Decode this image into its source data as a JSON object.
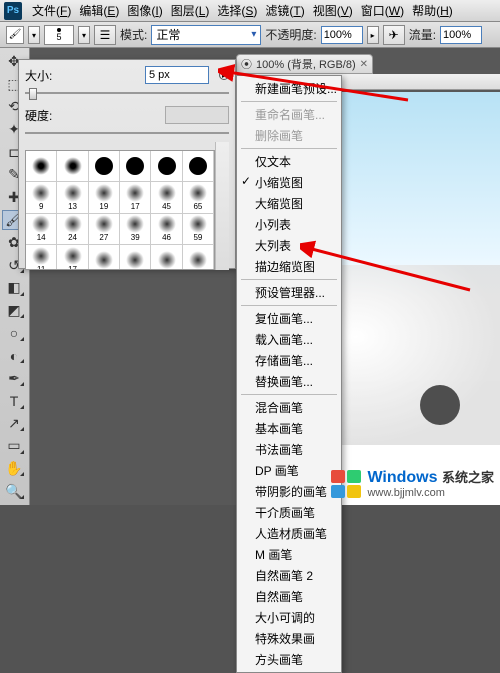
{
  "app": {
    "logo_text": "Ps"
  },
  "menubar": {
    "items": [
      {
        "label": "文件",
        "key": "F"
      },
      {
        "label": "编辑",
        "key": "E"
      },
      {
        "label": "图像",
        "key": "I"
      },
      {
        "label": "图层",
        "key": "L"
      },
      {
        "label": "选择",
        "key": "S"
      },
      {
        "label": "滤镜",
        "key": "T"
      },
      {
        "label": "视图",
        "key": "V"
      },
      {
        "label": "窗口",
        "key": "W"
      },
      {
        "label": "帮助",
        "key": "H"
      }
    ]
  },
  "optionsbar": {
    "brush_size_preview": "5",
    "mode_label": "模式:",
    "mode_value": "正常",
    "opacity_label": "不透明度:",
    "opacity_value": "100%",
    "flow_label": "流量:",
    "flow_value": "100%"
  },
  "document_tab": {
    "title": "100% (背景, RGB/8)"
  },
  "brush_popup": {
    "size_label": "大小:",
    "size_value": "5 px",
    "hardness_label": "硬度:",
    "presets": [
      {
        "type": "soft",
        "n": ""
      },
      {
        "type": "soft",
        "n": ""
      },
      {
        "type": "hard",
        "n": ""
      },
      {
        "type": "hard",
        "n": ""
      },
      {
        "type": "hard",
        "n": ""
      },
      {
        "type": "hard",
        "n": ""
      },
      {
        "type": "sc",
        "n": "9"
      },
      {
        "type": "sc",
        "n": "13"
      },
      {
        "type": "sc",
        "n": "19"
      },
      {
        "type": "sc",
        "n": "17"
      },
      {
        "type": "sc",
        "n": "45"
      },
      {
        "type": "sc",
        "n": "65"
      },
      {
        "type": "sc",
        "n": "14"
      },
      {
        "type": "sc",
        "n": "24"
      },
      {
        "type": "sc",
        "n": "27"
      },
      {
        "type": "sc",
        "n": "39"
      },
      {
        "type": "sc",
        "n": "46"
      },
      {
        "type": "sc",
        "n": "59"
      },
      {
        "type": "sc",
        "n": "11"
      },
      {
        "type": "sc",
        "n": "17"
      },
      {
        "type": "sc",
        "n": ""
      },
      {
        "type": "sc",
        "n": ""
      },
      {
        "type": "sc",
        "n": ""
      },
      {
        "type": "sc",
        "n": ""
      }
    ]
  },
  "context_menu": {
    "items": [
      {
        "label": "新建画笔预设",
        "ellipsis": true,
        "disabled": false
      },
      {
        "sep": true
      },
      {
        "label": "重命名画笔",
        "ellipsis": true,
        "disabled": true
      },
      {
        "label": "删除画笔",
        "disabled": true
      },
      {
        "sep": true
      },
      {
        "label": "仅文本"
      },
      {
        "label": "小缩览图",
        "checked": true
      },
      {
        "label": "大缩览图"
      },
      {
        "label": "小列表"
      },
      {
        "label": "大列表"
      },
      {
        "label": "描边缩览图"
      },
      {
        "sep": true
      },
      {
        "label": "预设管理器",
        "ellipsis": true
      },
      {
        "sep": true
      },
      {
        "label": "复位画笔",
        "ellipsis": true
      },
      {
        "label": "载入画笔",
        "ellipsis": true
      },
      {
        "label": "存储画笔",
        "ellipsis": true
      },
      {
        "label": "替换画笔",
        "ellipsis": true
      },
      {
        "sep": true
      },
      {
        "label": "混合画笔"
      },
      {
        "label": "基本画笔"
      },
      {
        "label": "书法画笔"
      },
      {
        "label": "DP 画笔"
      },
      {
        "label": "带阴影的画笔"
      },
      {
        "label": "干介质画笔"
      },
      {
        "label": "人造材质画笔"
      },
      {
        "label": "M 画笔"
      },
      {
        "label": "自然画笔 2"
      },
      {
        "label": "自然画笔"
      },
      {
        "label": "大小可调的",
        "truncated": true
      },
      {
        "label": "特殊效果画"
      },
      {
        "label": "方头画笔"
      }
    ]
  },
  "tools": [
    "move",
    "marquee",
    "lasso",
    "wand",
    "crop",
    "eyedropper",
    "heal",
    "brush",
    "stamp",
    "history",
    "eraser",
    "gradient",
    "blur",
    "dodge",
    "pen",
    "type",
    "path",
    "rect",
    "hand",
    "zoom"
  ],
  "watermark": {
    "title": "Windows",
    "subtitle": "系统之家",
    "url": "www.bjjmlv.com"
  }
}
